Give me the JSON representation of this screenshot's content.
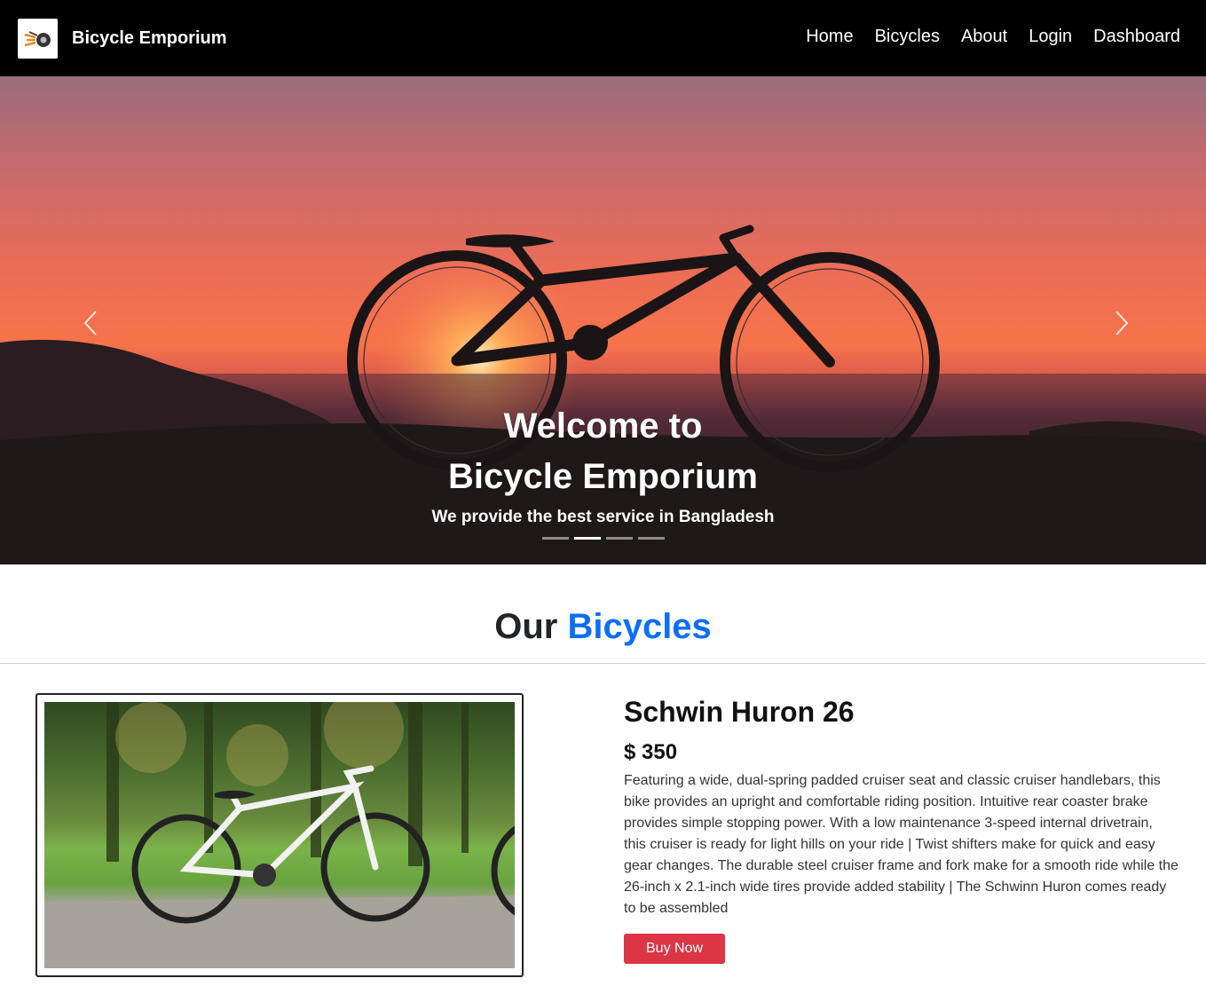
{
  "brand": {
    "name": "Bicycle Emporium"
  },
  "nav": {
    "items": [
      "Home",
      "Bicycles",
      "About",
      "Login",
      "Dashboard"
    ]
  },
  "hero": {
    "title_line1": "Welcome to",
    "title_line2": "Bicycle Emporium",
    "subtitle": "We provide the best service in Bangladesh",
    "slide_count": 4,
    "active_slide": 2
  },
  "section": {
    "title_prefix": "Our",
    "title_accent": "Bicycles"
  },
  "product": {
    "name": "Schwin Huron 26",
    "price": "$ 350",
    "description": "Featuring a wide, dual-spring padded cruiser seat and classic cruiser handlebars, this bike provides an upright and comfortable riding position. Intuitive rear coaster brake provides simple stopping power. With a low maintenance 3-speed internal drivetrain, this cruiser is ready for light hills on your ride | Twist shifters make for quick and easy gear changes. The durable steel cruiser frame and fork make for a smooth ride while the 26-inch x 2.1-inch wide tires provide added stability | The Schwinn Huron comes ready to be assembled",
    "buy_label": "Buy Now"
  },
  "colors": {
    "navbar": "#000000",
    "accent": "#0d6efd",
    "buy_button": "#dc3545"
  }
}
